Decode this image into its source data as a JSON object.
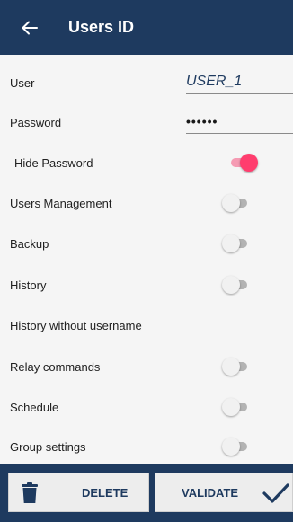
{
  "header": {
    "title": "Users ID",
    "back_icon": "arrow-left-icon"
  },
  "form": {
    "user_label": "User",
    "user_value": "USER_1",
    "password_label": "Password",
    "password_value": "••••••",
    "hide_password_label": "Hide Password"
  },
  "permissions": [
    {
      "label": "Users Management",
      "enabled": false
    },
    {
      "label": "Backup",
      "enabled": false
    },
    {
      "label": "History",
      "enabled": false
    },
    {
      "label": "History without username"
    },
    {
      "label": "Relay commands",
      "enabled": false
    },
    {
      "label": "Schedule",
      "enabled": false
    },
    {
      "label": "Group settings",
      "enabled": false
    }
  ],
  "hide_password_enabled": true,
  "footer": {
    "delete_label": "DELETE",
    "validate_label": "VALIDATE"
  },
  "colors": {
    "primary": "#1e3a5f",
    "accent": "#ff3d6e",
    "background": "#f5f5f5"
  }
}
